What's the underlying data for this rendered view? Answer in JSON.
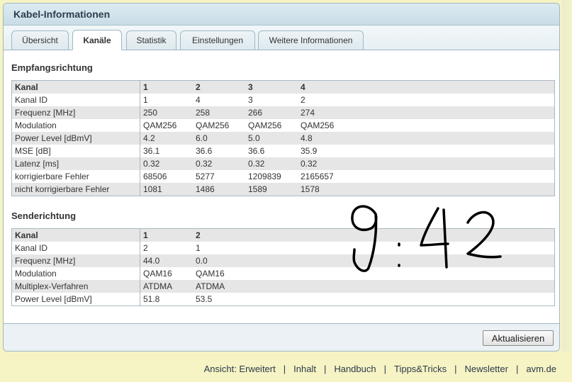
{
  "panel": {
    "title": "Kabel-Informationen"
  },
  "tabs": [
    {
      "label": "Übersicht"
    },
    {
      "label": "Kanäle"
    },
    {
      "label": "Statistik"
    },
    {
      "label": "Einstellungen"
    },
    {
      "label": "Weitere Informationen"
    }
  ],
  "downstream": {
    "title": "Empfangsrichtung",
    "header": [
      "Kanal",
      "1",
      "2",
      "3",
      "4"
    ],
    "rows": [
      [
        "Kanal ID",
        "1",
        "4",
        "3",
        "2"
      ],
      [
        "Frequenz [MHz]",
        "250",
        "258",
        "266",
        "274"
      ],
      [
        "Modulation",
        "QAM256",
        "QAM256",
        "QAM256",
        "QAM256"
      ],
      [
        "Power Level [dBmV]",
        "4.2",
        "6.0",
        "5.0",
        "4.8"
      ],
      [
        "MSE [dB]",
        "36.1",
        "36.6",
        "36.6",
        "35.9"
      ],
      [
        "Latenz [ms]",
        "0.32",
        "0.32",
        "0.32",
        "0.32"
      ],
      [
        "korrigierbare Fehler",
        "68506",
        "5277",
        "1209839",
        "2165657"
      ],
      [
        "nicht korrigierbare Fehler",
        "1081",
        "1486",
        "1589",
        "1578"
      ]
    ]
  },
  "upstream": {
    "title": "Senderichtung",
    "header": [
      "Kanal",
      "1",
      "2"
    ],
    "rows": [
      [
        "Kanal ID",
        "2",
        "1"
      ],
      [
        "Frequenz [MHz]",
        "44.0",
        "0.0"
      ],
      [
        "Modulation",
        "QAM16",
        "QAM16"
      ],
      [
        "Multiplex-Verfahren",
        "ATDMA",
        "ATDMA"
      ],
      [
        "Power Level [dBmV]",
        "51.8",
        "53.5"
      ]
    ]
  },
  "refresh_label": "Aktualisieren",
  "footer": [
    {
      "label": "Ansicht: Erweitert"
    },
    {
      "label": "Inhalt"
    },
    {
      "label": "Handbuch"
    },
    {
      "label": "Tipps&Tricks"
    },
    {
      "label": "Newsletter"
    },
    {
      "label": "avm.de"
    }
  ],
  "footer_separator": "|",
  "handwriting": "9:42"
}
